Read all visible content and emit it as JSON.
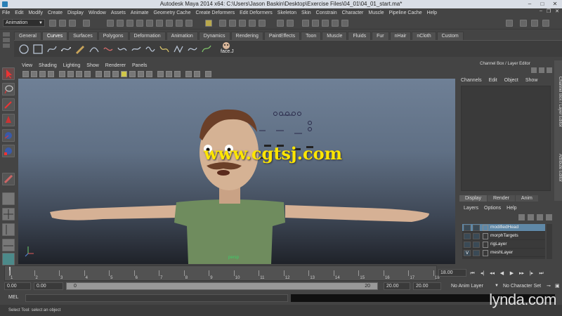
{
  "window": {
    "title": "Autodesk Maya 2014 x64: C:\\Users\\Jason Baskin\\Desktop\\Exercise Files\\04_01\\04_01_start.ma*"
  },
  "menubar": {
    "items": [
      "File",
      "Edit",
      "Modify",
      "Create",
      "Display",
      "Window",
      "Assets",
      "Animate",
      "Geometry Cache",
      "Create Deformers",
      "Edit Deformers",
      "Skeleton",
      "Skin",
      "Constrain",
      "Character",
      "Muscle",
      "Pipeline Cache",
      "Help"
    ]
  },
  "statusline": {
    "mode": "Animation"
  },
  "shelf": {
    "tabs": [
      "General",
      "Curves",
      "Surfaces",
      "Polygons",
      "Deformation",
      "Animation",
      "Dynamics",
      "Rendering",
      "PaintEffects",
      "Toon",
      "Muscle",
      "Fluids",
      "Fur",
      "nHair",
      "nCloth",
      "Custom"
    ],
    "active_tab": "Curves",
    "face_label": "face.J"
  },
  "panel": {
    "menu": [
      "View",
      "Shading",
      "Lighting",
      "Show",
      "Renderer",
      "Panels"
    ],
    "camera": "persp"
  },
  "channel_box": {
    "title": "Channel Box / Layer Editor",
    "menu": [
      "Channels",
      "Edit",
      "Object",
      "Show"
    ]
  },
  "side_tabs": [
    "Channel Box / Layer Editor",
    "Attribute Editor"
  ],
  "layer_editor": {
    "tabs": [
      "Display",
      "Render",
      "Anim"
    ],
    "active_tab": "Display",
    "menu": [
      "Layers",
      "Options",
      "Help"
    ],
    "layers": [
      {
        "name": "modifiedHead",
        "selected": true,
        "v": ""
      },
      {
        "name": "morphTargets",
        "selected": false,
        "v": ""
      },
      {
        "name": "rigLayer",
        "selected": false,
        "v": ""
      },
      {
        "name": "meshLayer",
        "selected": false,
        "v": "V"
      }
    ]
  },
  "time_slider": {
    "ticks": [
      "1",
      "2",
      "3",
      "4",
      "5",
      "6",
      "7",
      "8",
      "9",
      "10",
      "11",
      "12",
      "13",
      "14",
      "15",
      "16",
      "17",
      "18"
    ],
    "current_frame": 1,
    "end_time": "18.00"
  },
  "range": {
    "start": "0.00",
    "anim_start": "0.00",
    "slider_low": "0",
    "slider_high": "20",
    "anim_end": "20.00",
    "end": "20.00",
    "anim_layer": "No Anim Layer",
    "character_set": "No Character Set"
  },
  "command_line": {
    "label": "MEL"
  },
  "help_line": {
    "text": "Select Tool: select an object"
  },
  "watermark": "www.cgtsj.com",
  "logo": "lynda.com",
  "colors": {
    "selection": "#5f88a7",
    "camera_label": "#3ad06a",
    "watermark": "#ffe600"
  }
}
